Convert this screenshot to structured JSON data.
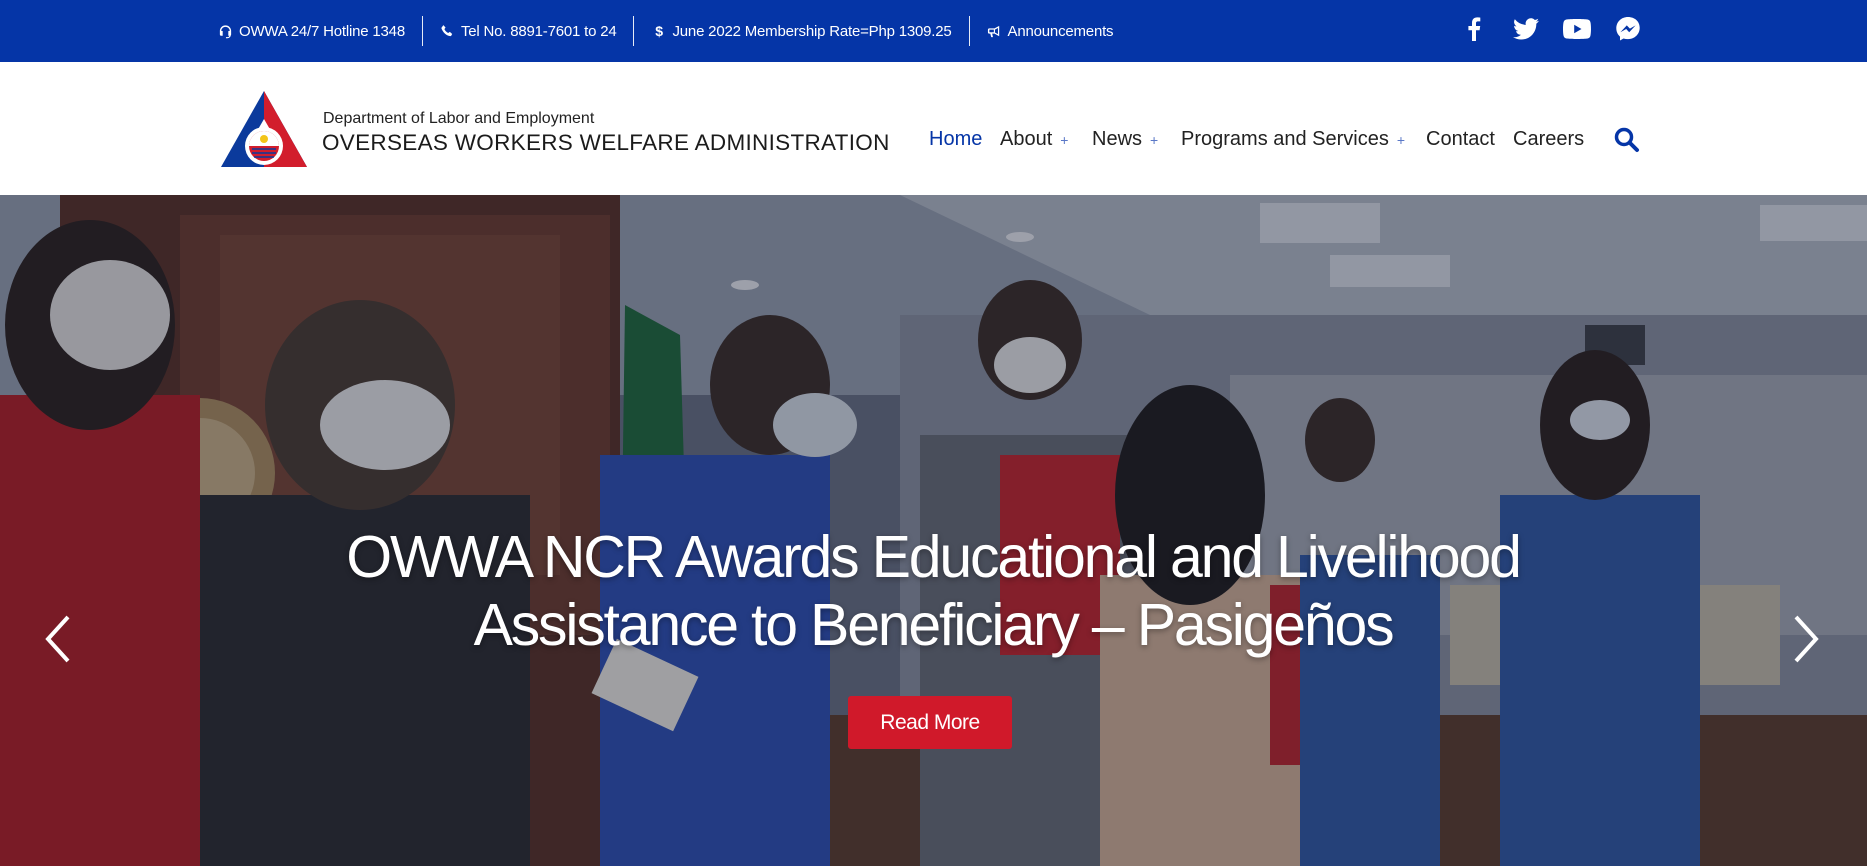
{
  "topbar": {
    "hotline": "OWWA 24/7 Hotline 1348",
    "tel": "Tel No. 8891-7601 to 24",
    "membership": "June 2022 Membership Rate=Php 1309.25",
    "announcements": "Announcements",
    "social": [
      "facebook-icon",
      "twitter-icon",
      "youtube-icon",
      "messenger-icon"
    ]
  },
  "header": {
    "department": "Department of Labor and Employment",
    "agency": "OVERSEAS WORKERS WELFARE ADMINISTRATION"
  },
  "nav": {
    "home": "Home",
    "about": "About",
    "news": "News",
    "programs": "Programs and Services",
    "contact": "Contact",
    "careers": "Careers",
    "plus": "+"
  },
  "hero": {
    "title_line1": "OWWA NCR Awards Educational and Livelihood",
    "title_line2": "Assistance to Beneficiary – Pasigeños",
    "button": "Read More"
  },
  "colors": {
    "brand_blue": "#0535a7",
    "accent_red": "#d0192a"
  }
}
